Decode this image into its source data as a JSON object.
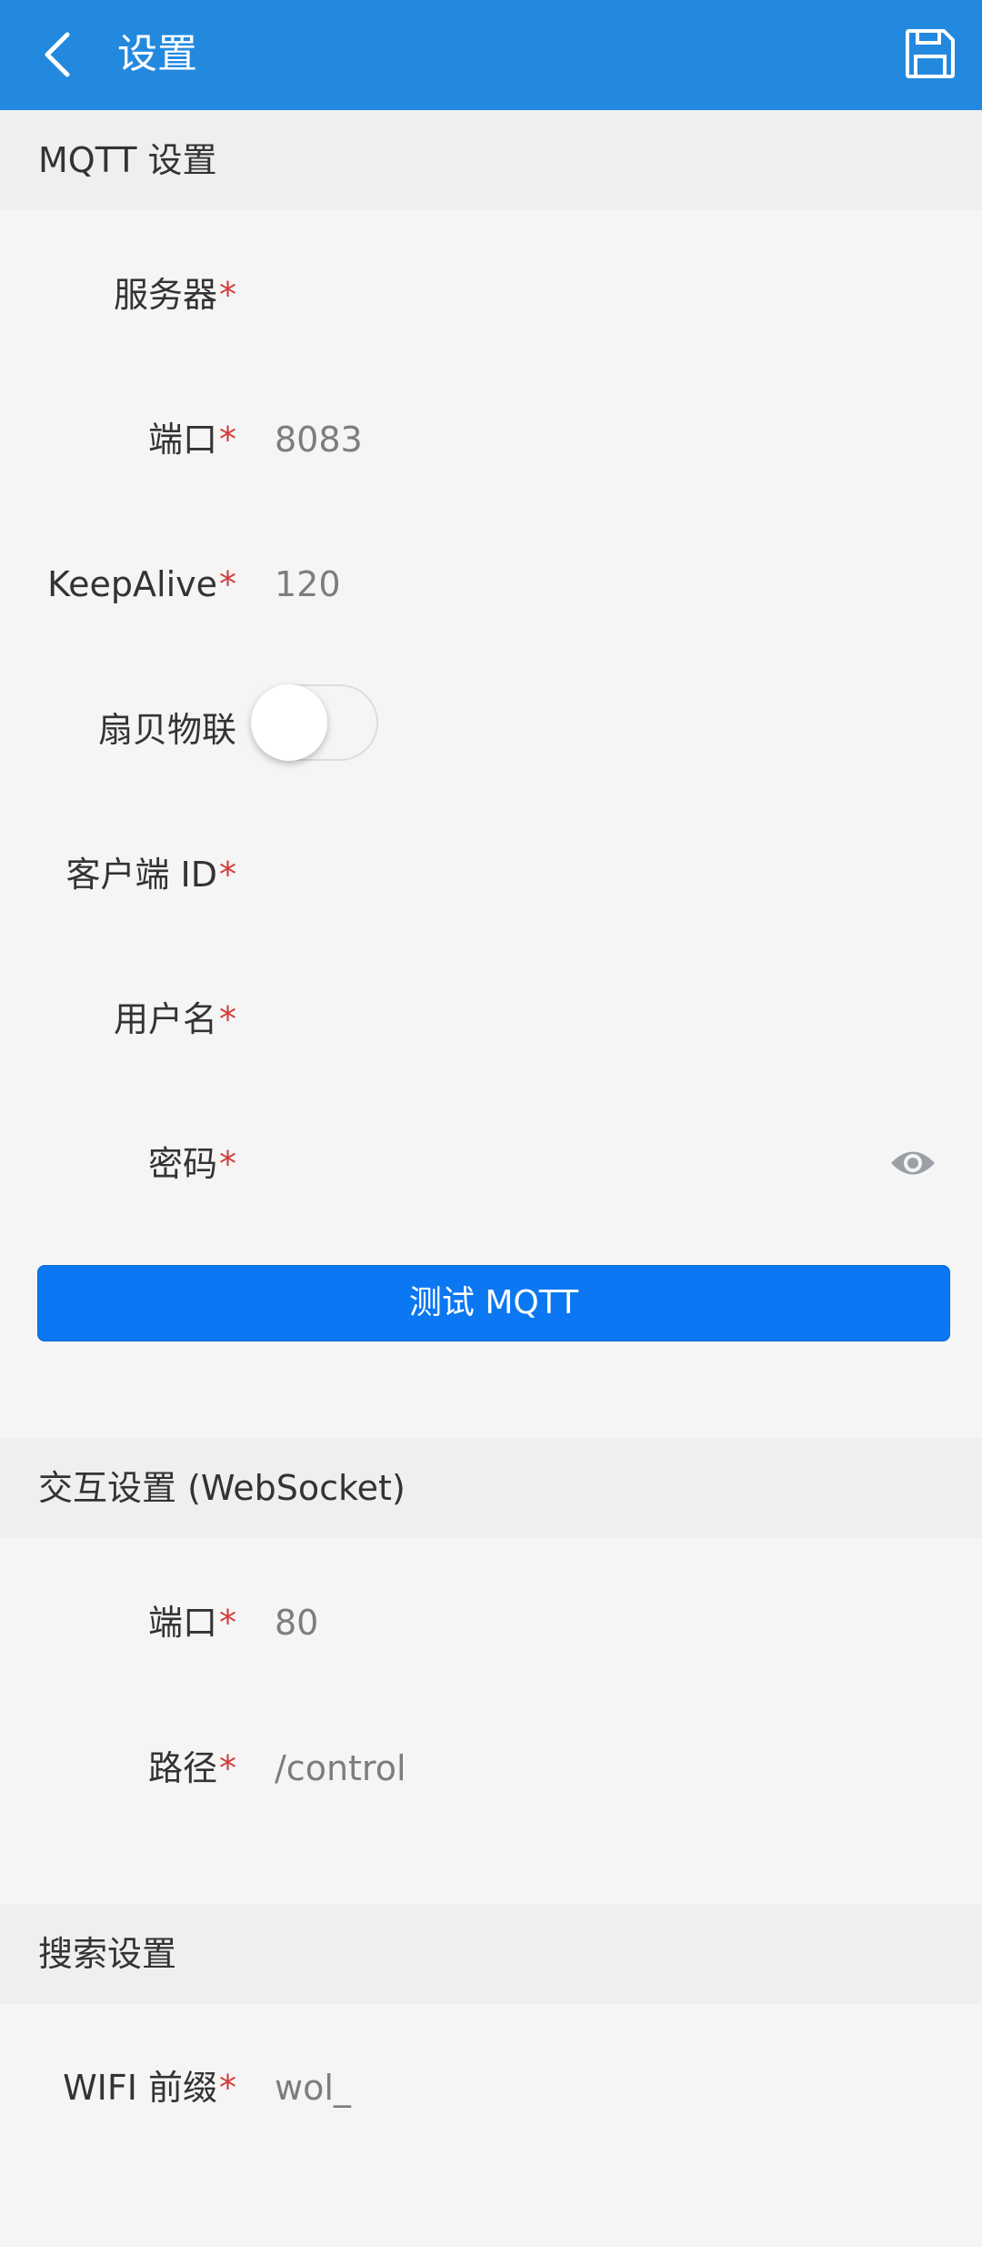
{
  "header": {
    "title": "设置",
    "icons": {
      "back": "chevron-left-icon",
      "save": "floppy-disk-icon"
    },
    "background": "#2389df"
  },
  "mqtt": {
    "section_title": "MQTT 设置",
    "server_label": "服务器",
    "server_value": "",
    "port_label": "端口",
    "port_value": "8083",
    "keepalive_label": "KeepAlive",
    "keepalive_value": "120",
    "shanbei_label": "扇贝物联",
    "shanbei_enabled": false,
    "client_id_label": "客户端 ID",
    "client_id_value": "",
    "username_label": "用户名",
    "username_value": "",
    "password_label": "密码",
    "password_value": "",
    "password_toggle_icon": "eye-icon",
    "test_button": "测试 MQTT"
  },
  "websocket": {
    "section_title": "交互设置 (WebSocket)",
    "port_label": "端口",
    "port_value": "80",
    "path_label": "路径",
    "path_value": "/control"
  },
  "search": {
    "section_title": "搜索设置",
    "wifi_prefix_label": "WIFI 前缀",
    "wifi_prefix_value": "wol_"
  },
  "required_marker": "*",
  "colors": {
    "accent": "#0b77f2",
    "required": "#d33c3c"
  }
}
